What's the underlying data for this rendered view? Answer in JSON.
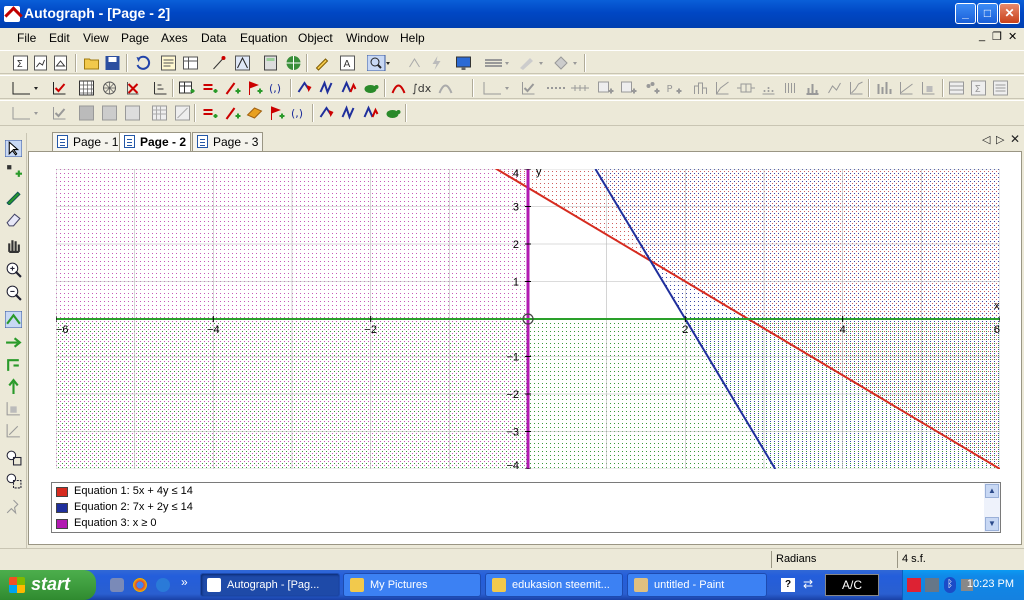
{
  "window": {
    "title": "Autograph - [Page - 2]"
  },
  "menu": [
    "File",
    "Edit",
    "View",
    "Page",
    "Axes",
    "Data",
    "Equation",
    "Object",
    "Window",
    "Help"
  ],
  "tabs": [
    "Page - 1",
    "Page - 2",
    "Page - 3"
  ],
  "active_tab": 1,
  "colors": {
    "red": "#d62b1f",
    "blue": "#1f2f9c",
    "magenta": "#b21ab2",
    "green": "#2aa02a"
  },
  "graph": {
    "xlim": [
      -6,
      6
    ],
    "ylim": [
      -4,
      4
    ],
    "x_axis_label": "x",
    "y_axis_label": "y",
    "x_ticks": [
      -6,
      -4,
      -2,
      2,
      4,
      6
    ],
    "y_ticks": [
      -4,
      -3,
      -2,
      -1,
      1,
      2,
      3,
      4
    ],
    "lines": [
      {
        "name": "Equation 1",
        "a": 5,
        "b": 4,
        "c": 14,
        "color": "#d62b1f"
      },
      {
        "name": "Equation 2",
        "a": 7,
        "b": 2,
        "c": 14,
        "color": "#1f2f9c"
      }
    ],
    "vertical_line_x": 0
  },
  "legend": [
    {
      "label": "Equation 1: 5x + 4y  ≤ 14",
      "color": "#d62b1f"
    },
    {
      "label": "Equation 2: 7x + 2y ≤ 14",
      "color": "#1f2f9c"
    },
    {
      "label": "Equation 3: x ≥ 0",
      "color": "#b21ab2"
    }
  ],
  "status": {
    "angle": "Radians",
    "precision": "4 s.f."
  },
  "taskbar": {
    "start": "start",
    "tasks": [
      "Autograph - [Pag...",
      "My Pictures",
      "edukasion steemit...",
      "untitled - Paint"
    ],
    "input_mode": "A/C",
    "clock": "10:23 PM"
  }
}
